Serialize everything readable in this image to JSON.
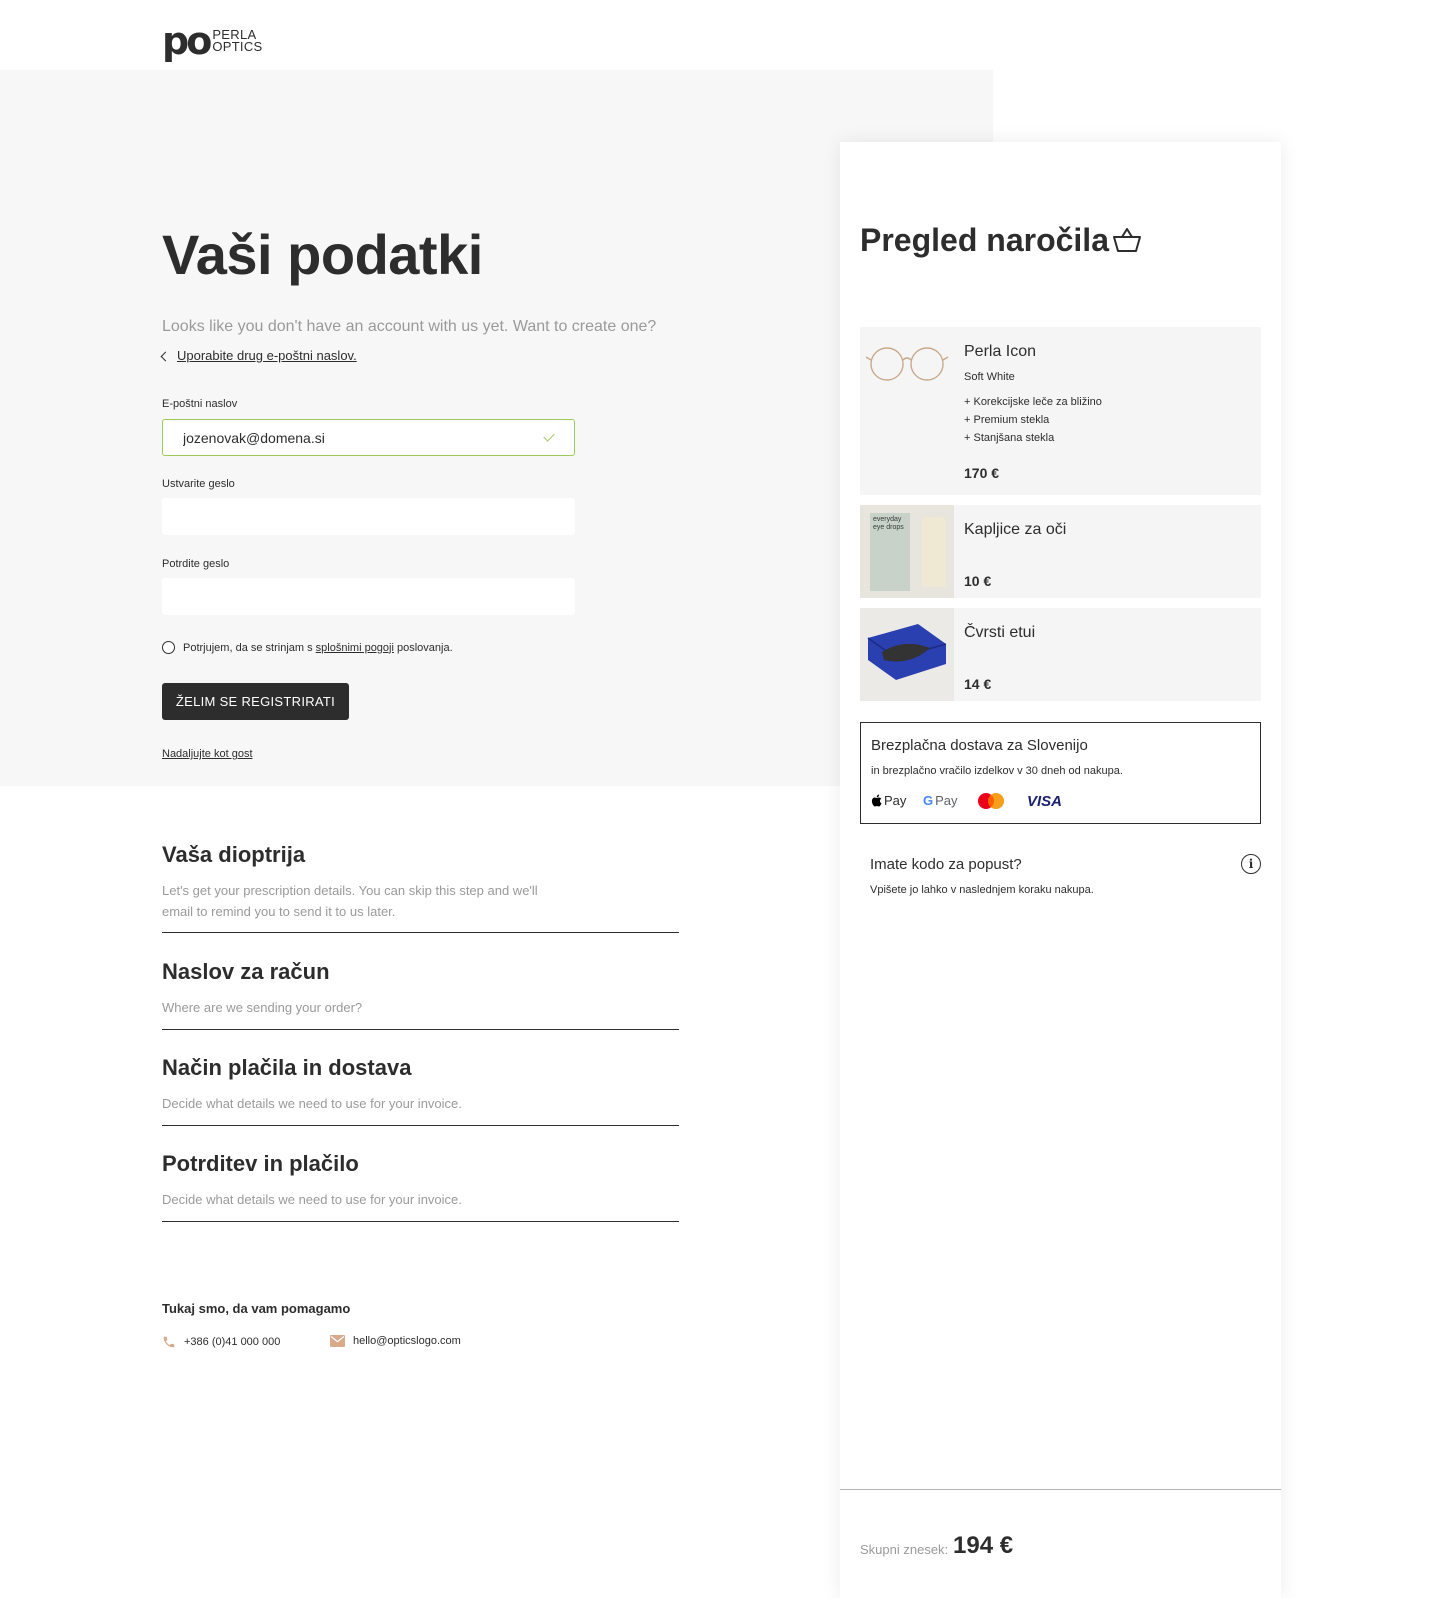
{
  "brand": {
    "mark": "po",
    "line1": "PERLA",
    "line2": "OPTICS"
  },
  "form": {
    "title": "Vaši podatki",
    "lead": "Looks like you don't have an account with us yet. Want to create one?",
    "back_link": "Uporabite drug e-poštni naslov.",
    "email_label": "E-poštni naslov",
    "email_value": "jozenovak@domena.si",
    "password_label": "Ustvarite geslo",
    "confirm_label": "Potrdite geslo",
    "terms_prefix": "Potrjujem, da se strinjam s",
    "terms_link": "splošnimi pogoji",
    "terms_suffix": "poslovanja.",
    "register_button": "ŽELIM SE REGISTRIRATI",
    "guest_link": "Nadaljujte kot gost"
  },
  "steps": [
    {
      "title": "Vaša dioptrija",
      "desc": "Let's get your prescription details. You can skip this step and we'll email to remind you to send it to us later."
    },
    {
      "title": "Naslov za račun",
      "desc": "Where are we sending your order?"
    },
    {
      "title": "Način plačila in dostava",
      "desc": "Decide what details we need to use for your invoice."
    },
    {
      "title": "Potrditev in plačilo",
      "desc": "Decide what details we need to use for your invoice."
    }
  ],
  "help": {
    "title": "Tukaj smo, da vam pomagamo",
    "phone": "+386 (0)41 000 000",
    "email": "hello@opticslogo.com",
    "icon_color": "#d9a98c"
  },
  "order": {
    "title": "Pregled naročila",
    "items": [
      {
        "name": "Perla Icon",
        "variant": "Soft White",
        "options": [
          "+ Korekcijske leče za bližino",
          "+ Premium stekla",
          "+ Stanjšana stekla"
        ],
        "price": "170 €"
      },
      {
        "name": "Kapljice za oči",
        "price": "10 €",
        "thumb_text_1": "everyday",
        "thumb_text_2": "eye drops"
      },
      {
        "name": "Čvrsti etui",
        "price": "14 €"
      }
    ],
    "shipping_title": "Brezplačna dostava za Slovenijo",
    "shipping_sub": "in brezplačno vračilo izdelkov v 30 dneh od nakupa.",
    "payments": {
      "apple": "Pay",
      "google": "Pay",
      "visa": "VISA"
    },
    "promo_title": "Imate kodo za popust?",
    "promo_sub": "Vpišete jo lahko v naslednjem koraku nakupa.",
    "total_label": "Skupni znesek:",
    "total_value": "194 €"
  },
  "colors": {
    "accent_valid": "#9ccb57",
    "dark": "#2d2d2d",
    "muted": "#9a9a9a",
    "band": "#f7f7f7"
  }
}
